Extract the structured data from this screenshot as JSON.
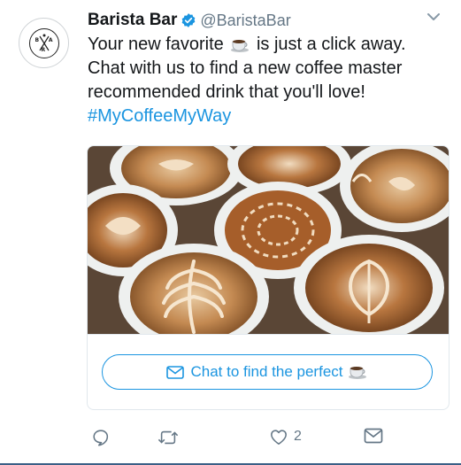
{
  "tweet": {
    "author": {
      "name": "Barista Bar",
      "handle": "@BaristaBar",
      "avatar_letters": [
        "B",
        "A",
        "R"
      ],
      "verified": true
    },
    "text": {
      "line1_before_emoji": "Your new favorite",
      "line1_after_emoji": "is just a click away.",
      "line2": "Chat with us to find a new coffee master",
      "line3": "recommended drink that you'll love!",
      "hashtag": "#MyCoffeeMyWay",
      "emoji": "coffee-cup-icon"
    },
    "card": {
      "image": "latte-art-coffee-cups-photo",
      "cta_label": "Chat to find the perfect",
      "cta_icon": "envelope-icon",
      "cta_emoji": "coffee-cup-icon"
    },
    "actions": {
      "reply_count": "",
      "retweet_count": "",
      "like_count": "2"
    },
    "colors": {
      "link_blue": "#1b95e0",
      "muted_gray": "#657786",
      "text": "#14171a",
      "border": "#e1e8ed"
    }
  }
}
